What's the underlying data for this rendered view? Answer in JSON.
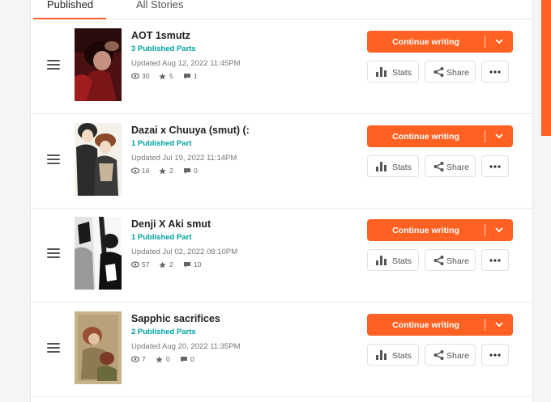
{
  "tabs": [
    {
      "label": "Published"
    },
    {
      "label": "All Stories"
    }
  ],
  "stories": [
    {
      "title": "AOT 1smutz",
      "parts": "3 Published Parts",
      "updated": "Updated Aug 12, 2022 11:45PM",
      "reads": "30",
      "votes": "5",
      "comments": "1"
    },
    {
      "title": "Dazai x Chuuya (smut) (:",
      "parts": "1 Published Part",
      "updated": "Updated Jul 19, 2022 11:14PM",
      "reads": "16",
      "votes": "2",
      "comments": "0"
    },
    {
      "title": "Denji X Aki smut",
      "parts": "1 Published Part",
      "updated": "Updated Jul 02, 2022 08:10PM",
      "reads": "57",
      "votes": "2",
      "comments": "10"
    },
    {
      "title": "Sapphic sacrifices",
      "parts": "2 Published Parts",
      "updated": "Updated Aug 20, 2022 11:35PM",
      "reads": "7",
      "votes": "0",
      "comments": "0"
    }
  ],
  "actions": {
    "continue_label": "Continue writing",
    "stats_label": "Stats",
    "share_label": "Share"
  },
  "icons": {
    "drag": "hamburger-drag-icon",
    "reads": "eye-icon",
    "votes": "star-icon",
    "comments": "comment-icon",
    "stats": "bar-chart-icon",
    "share": "share-icon",
    "more": "ellipsis-icon",
    "dropdown": "chevron-down-icon"
  },
  "colors": {
    "accent": "#ff6122",
    "parts": "#00a0a0"
  }
}
